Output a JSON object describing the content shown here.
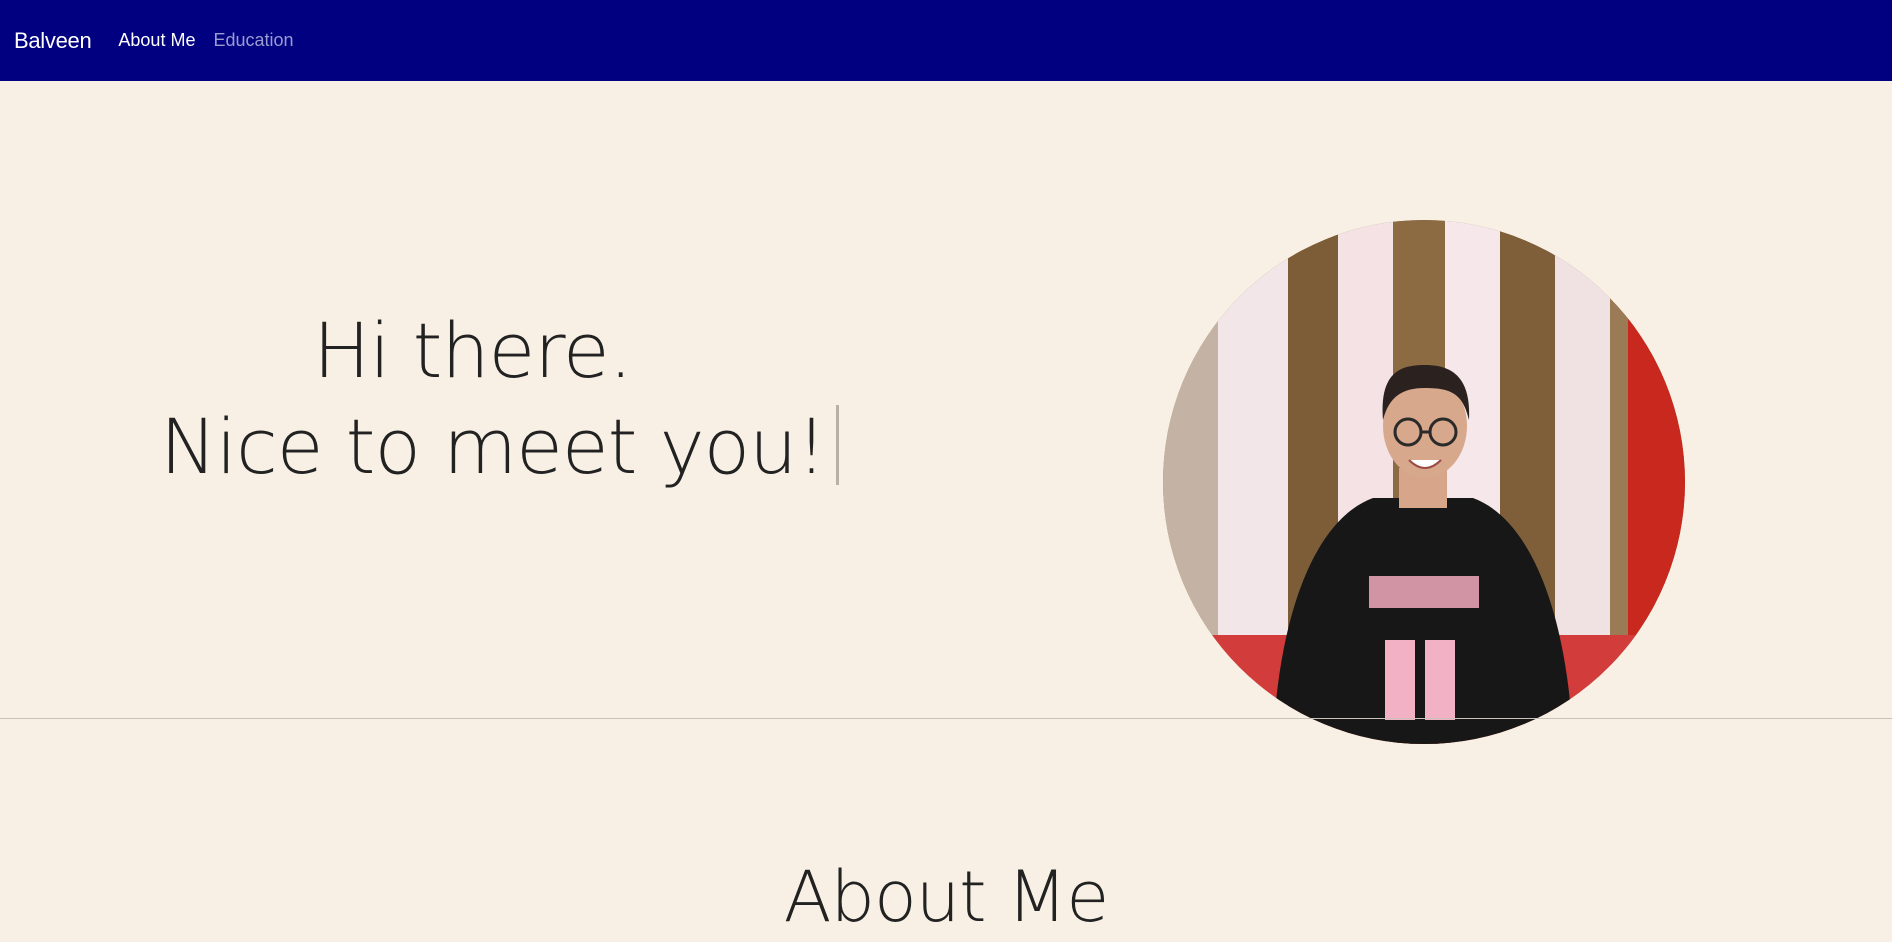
{
  "navbar": {
    "brand": "Balveen",
    "links": [
      "About Me",
      "Education"
    ],
    "background": "#000080"
  },
  "hero": {
    "line1": "Hi there.",
    "line2": "Nice to meet you!",
    "photo_alt": "Profile photo of Balveen"
  },
  "about": {
    "title": "About Me"
  },
  "colors": {
    "page_background": "#f8f0e4",
    "text": "#222222"
  }
}
